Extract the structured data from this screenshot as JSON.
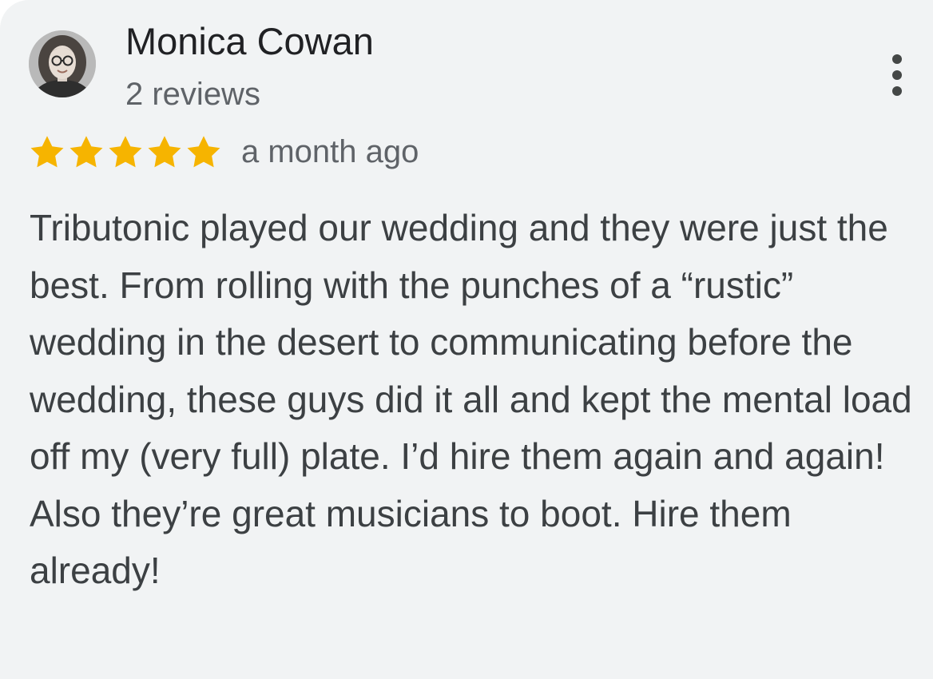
{
  "review": {
    "author_name": "Monica Cowan",
    "review_count": "2 reviews",
    "rating": 5,
    "rating_max": 5,
    "time_ago": "a month ago",
    "text": "Tributonic played our wedding and they were just the best. From rolling with the punches of a “rustic” wedding in the desert to communicating before the wedding, these guys did it all and kept the mental load off my (very full) plate. I’d hire them again and again! Also they’re great musicians to boot. Hire them already!"
  },
  "icons": {
    "avatar": "user-avatar-photo",
    "more": "more-vert-icon",
    "star": "star-icon"
  },
  "colors": {
    "background": "#f1f3f4",
    "star": "#f6b400",
    "text_primary": "#202124",
    "text_secondary": "#5f6368",
    "body_text": "#3c4043"
  }
}
